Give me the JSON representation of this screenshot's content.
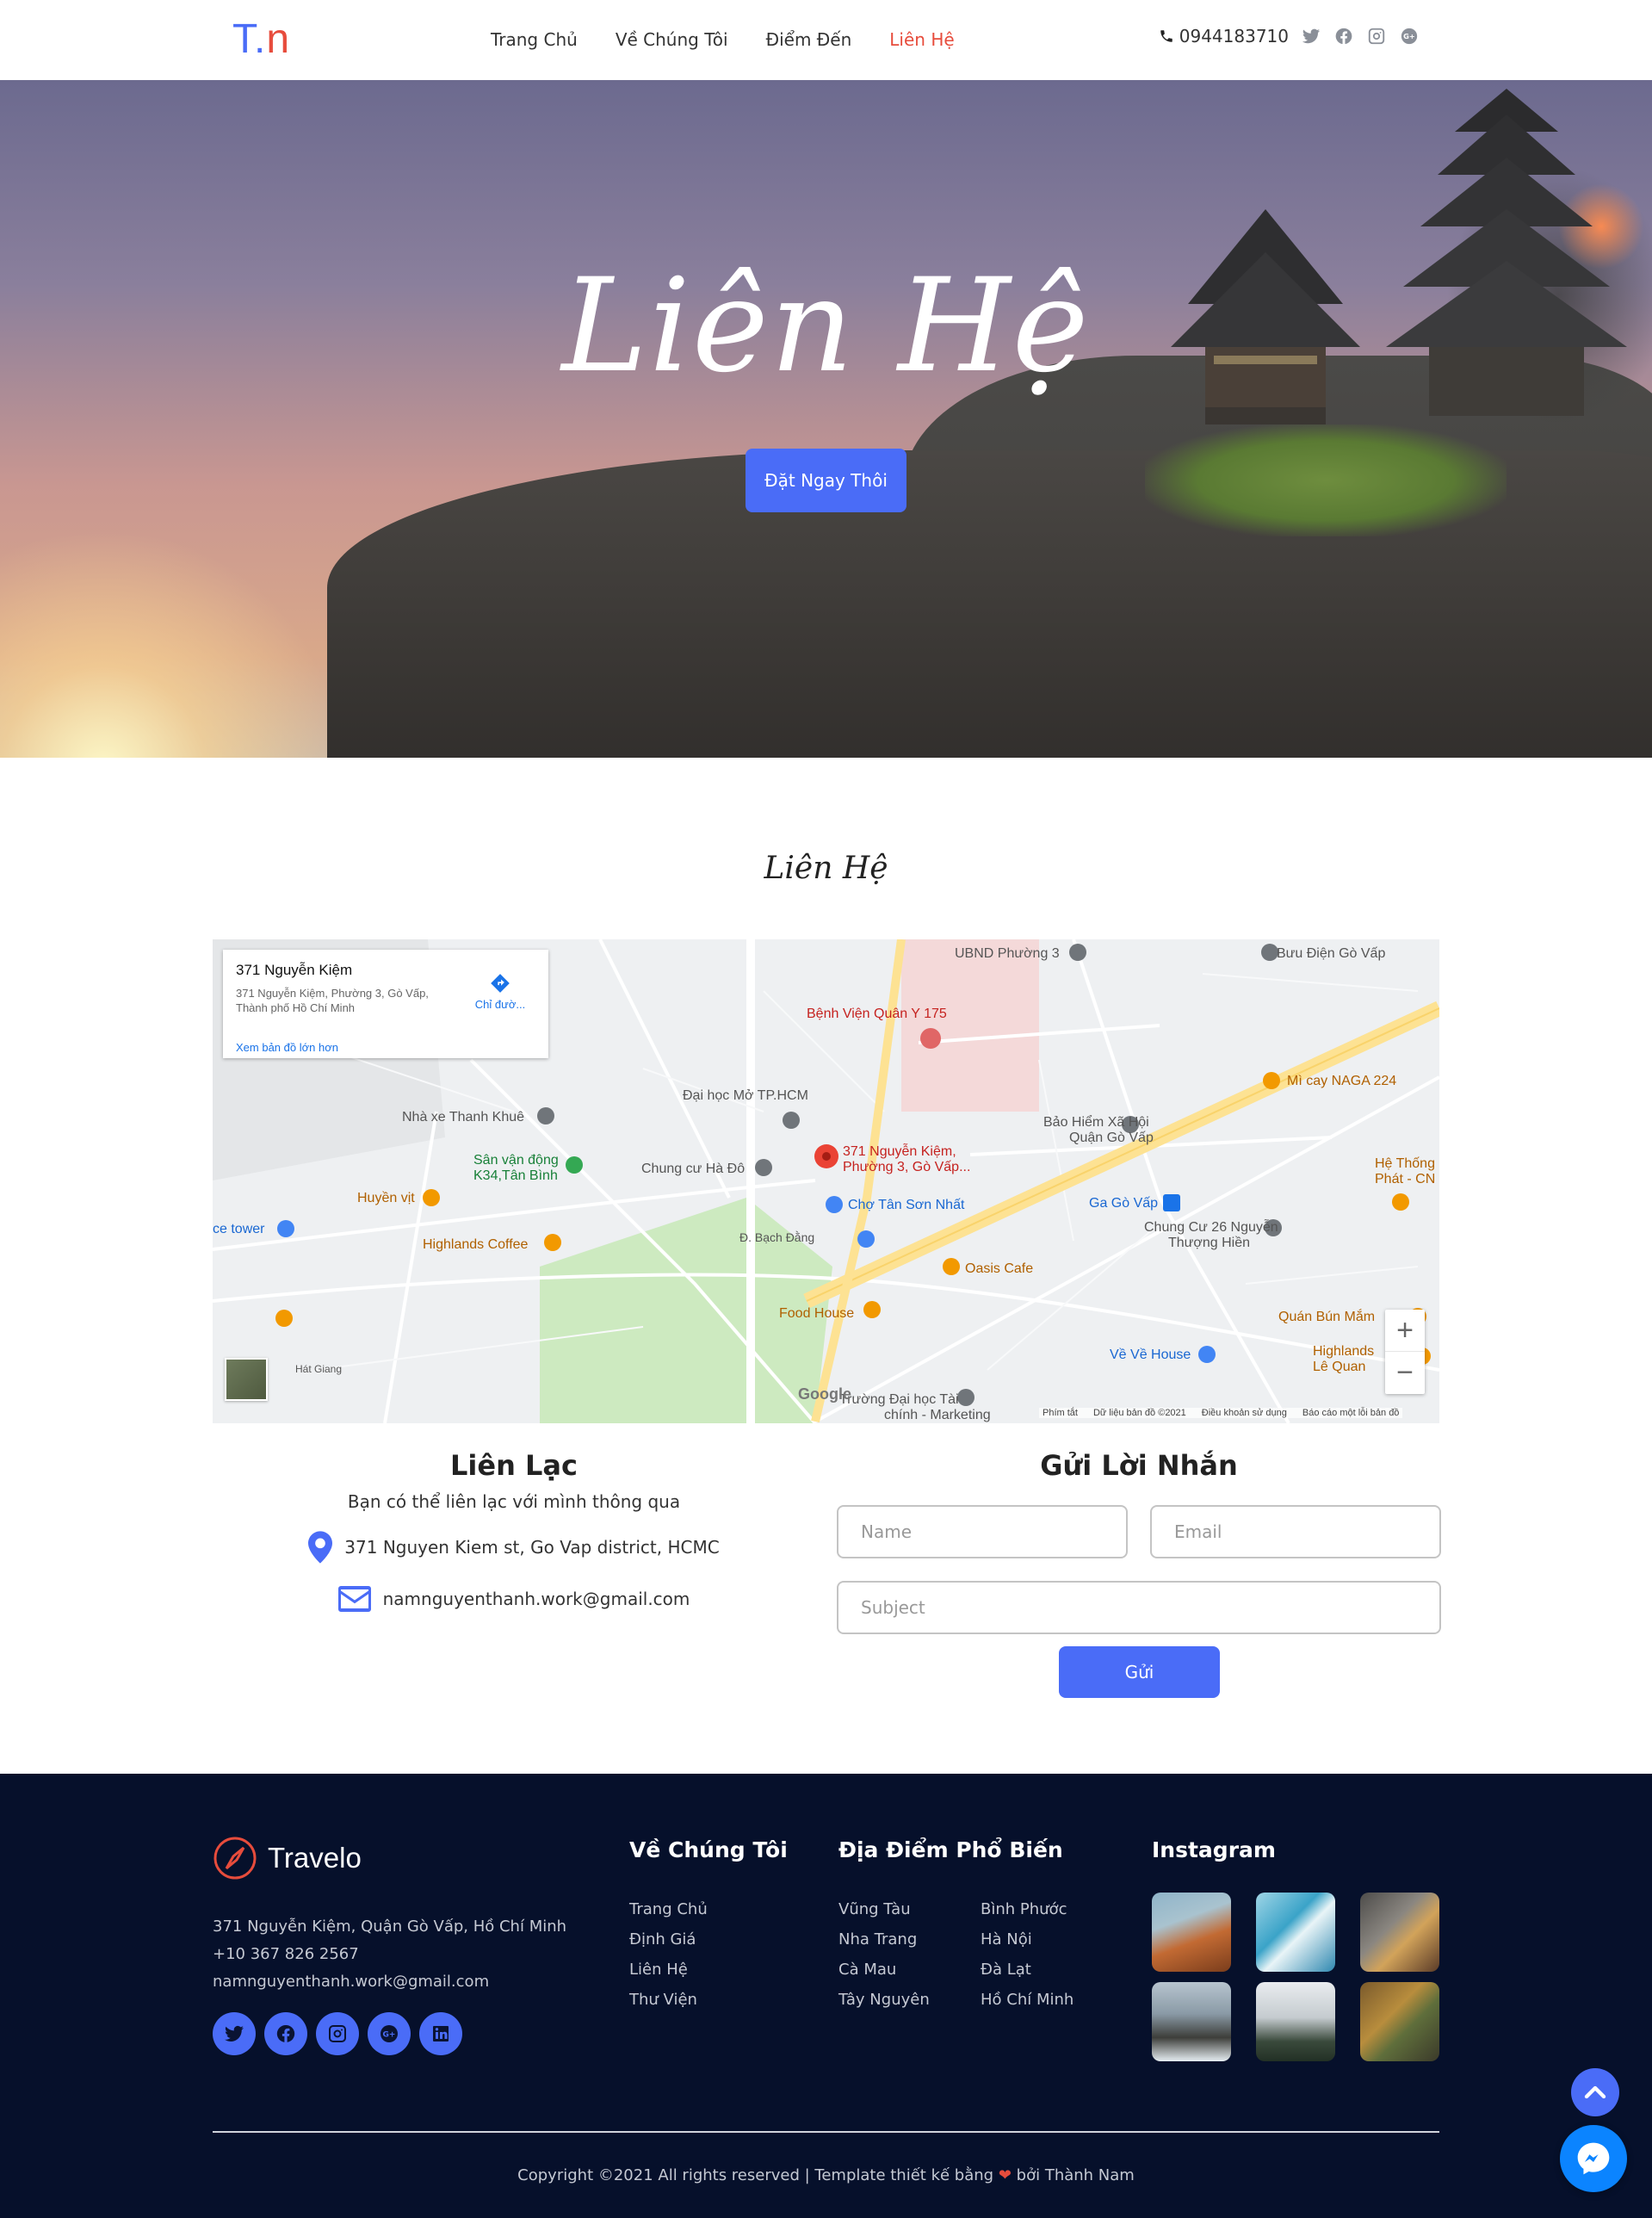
{
  "header": {
    "logo": {
      "t": "T",
      "dot": ".",
      "n": "n"
    },
    "nav": [
      {
        "label": "Trang Chủ",
        "active": false
      },
      {
        "label": "Về Chúng Tôi",
        "active": false
      },
      {
        "label": "Điểm Đến",
        "active": false
      },
      {
        "label": "Liên Hệ",
        "active": true
      }
    ],
    "phone": "0944183710",
    "social_icons": [
      "twitter-icon",
      "facebook-icon",
      "instagram-icon",
      "google-plus-icon"
    ]
  },
  "hero": {
    "title": "Liên Hệ",
    "button_label": "Đặt Ngay Thôi"
  },
  "section_title": "Liên Hệ",
  "map": {
    "card": {
      "title": "371 Nguyễn Kiệm",
      "address": "371 Nguyễn Kiệm, Phường 3, Gò Vấp, Thành phố Hồ Chí Minh",
      "directions": "Chỉ đườ...",
      "larger_map": "Xem bản đồ lớn hơn"
    },
    "labels": {
      "ubnd": "UBND Phường 3",
      "buudien": "Bưu Điện Gò Vấp",
      "benhvien": "Bệnh Viện Quân Y 175",
      "daihoc": "Đại học Mở TP.HCM",
      "nhaxe": "Nhà xe Thanh Khuê",
      "svd1": "Sân vận động",
      "svd2": "K34,Tân Bình",
      "chungcu_hado": "Chung cư Hà Đô",
      "pin1": "371 Nguyễn Kiệm,",
      "pin2": "Phường 3, Gò Vấp...",
      "baohiem1": "Bảo Hiểm Xã Hội",
      "baohiem2": "Quận Gò Vấp",
      "micay": "Mì cay NAGA 224",
      "hethong1": "Hệ Thống",
      "hethong2": "Phát - CN",
      "huyenvit": "Huyền vịt",
      "chotsn": "Chợ Tân Sơn Nhất",
      "gagovap": "Ga Gò Vấp",
      "chungcu26a": "Chung Cư 26 Nguyễn",
      "chungcu26b": "Thượng Hiền",
      "icetower": "ce tower",
      "highlands": "Highlands Coffee",
      "oasis": "Oasis Cafe",
      "foodhouse": "Food House",
      "quanbun": "Quán Bún Mắm",
      "vevehouse": "Về Về House",
      "highlands2a": "Highlands",
      "highlands2b": "Lê Quan",
      "dhtc1": "Trường Đại học Tài",
      "dhtc2": "chính - Marketing",
      "hatgiang": "Hát Giang",
      "bachdang": "Đ. Bạch Đằng"
    },
    "zoom_in": "+",
    "zoom_out": "−",
    "google": "Google",
    "footer": [
      "Phím tắt",
      "Dữ liệu bản đồ ©2021",
      "Điều khoản sử dụng",
      "Báo cáo một lỗi bản đồ"
    ]
  },
  "contact": {
    "title": "Liên Lạc",
    "subtitle": "Bạn có thể liên lạc với mình thông qua",
    "address": "371 Nguyen Kiem st, Go Vap district, HCMC",
    "email": "namnguyenthanh.work@gmail.com"
  },
  "form": {
    "title": "Gửi Lời Nhắn",
    "name_placeholder": "Name",
    "email_placeholder": "Email",
    "subject_placeholder": "Subject",
    "submit_label": "Gửi"
  },
  "footer": {
    "brand": "Travelo",
    "address": "371 Nguyễn Kiệm, Quận Gò Vấp, Hồ Chí Minh",
    "phone": "+10 367 826 2567",
    "email": "namnguyenthanh.work@gmail.com",
    "social_icons": [
      "twitter-icon",
      "facebook-icon",
      "instagram-icon",
      "google-plus-icon",
      "linkedin-icon"
    ],
    "about": {
      "title": "Về Chúng Tôi",
      "links": [
        "Trang Chủ",
        "Định Giá",
        "Liên Hệ",
        "Thư Viện"
      ]
    },
    "places": {
      "title": "Địa Điểm Phổ Biến",
      "col1": [
        "Vũng Tàu",
        "Nha Trang",
        "Cà Mau",
        "Tây Nguyên"
      ],
      "col2": [
        "Bình Phước",
        "Hà Nội",
        "Đà Lạt",
        "Hồ Chí Minh"
      ]
    },
    "instagram": {
      "title": "Instagram"
    },
    "copyright_pre": "Copyright ©2021 All rights reserved | Template thiết kế bằng",
    "copyright_post": "bởi Thành Nam"
  },
  "colors": {
    "accent": "#4a6cf7",
    "active_nav": "#e74c3c",
    "footer_bg": "#06102b"
  }
}
